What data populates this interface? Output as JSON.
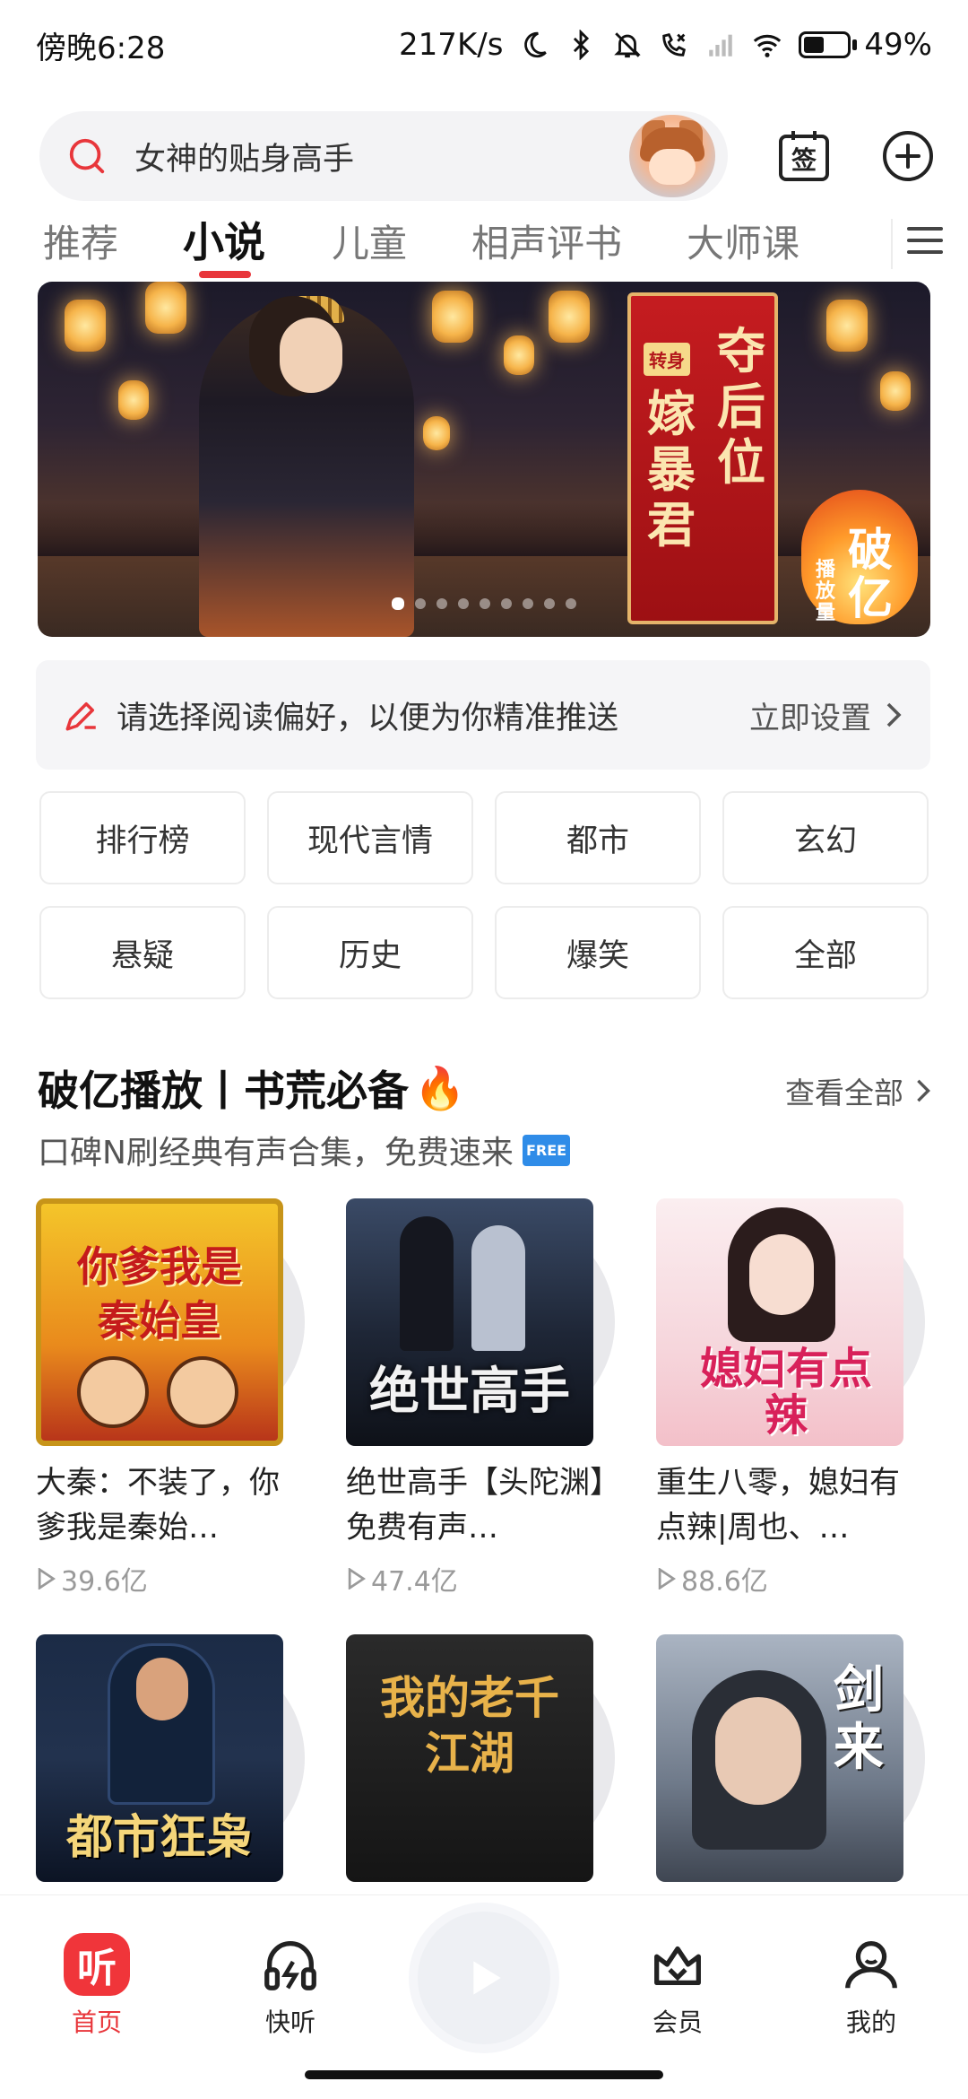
{
  "status_bar": {
    "time": "傍晚6:28",
    "network_speed": "217K/s",
    "battery": "49%",
    "battery_level_percent": 49,
    "icons": [
      "moon-icon",
      "bluetooth-icon",
      "mute-icon",
      "call-forward-icon",
      "signal-icon",
      "wifi-icon",
      "battery-icon"
    ]
  },
  "search": {
    "placeholder": "女神的贴身高手",
    "icons": [
      "search-icon",
      "avatar",
      "sign-in-icon",
      "add-icon"
    ],
    "sign_in_label": "签"
  },
  "tabs": {
    "items": [
      "推荐",
      "小说",
      "儿童",
      "相声评书",
      "大师课"
    ],
    "active": "小说",
    "accent_color": "#e8363b"
  },
  "banner": {
    "book_title_col1": "夺后位",
    "book_title_col2": "嫁暴君",
    "tag": "转身",
    "badge_small": "播放量",
    "badge_big": "破亿",
    "page_count": 9,
    "active_page": 1
  },
  "preference": {
    "text": "请选择阅读偏好，以便为你精准推送",
    "action": "立即设置"
  },
  "categories": [
    "排行榜",
    "现代言情",
    "都市",
    "玄幻",
    "悬疑",
    "历史",
    "爆笑",
    "全部"
  ],
  "section": {
    "title": "破亿播放丨书荒必备",
    "title_emoji": "🔥",
    "subtitle": "口碑N刷经典有声合集，免费速来",
    "free_badge": "FREE",
    "more": "查看全部"
  },
  "books": [
    {
      "title": "大秦：不装了，你爹我是秦始…",
      "plays": "39.6亿",
      "cover_text": "你爹我是秦始皇"
    },
    {
      "title": "绝世高手【头陀渊】免费有声…",
      "plays": "47.4亿",
      "cover_text": "绝世高手"
    },
    {
      "title": "重生八零，媳妇有点辣|周也、…",
      "plays": "88.6亿",
      "cover_text": "媳妇有点辣"
    },
    {
      "title": "",
      "plays": "",
      "cover_text": "都市狂枭"
    },
    {
      "title": "",
      "plays": "",
      "cover_text": "我的老千江湖"
    },
    {
      "title": "",
      "plays": "",
      "cover_text": "剑来"
    }
  ],
  "bottom_nav": {
    "items": [
      {
        "label": "首页",
        "icon": "home-icon",
        "active": true
      },
      {
        "label": "快听",
        "icon": "headphones-icon",
        "active": false
      },
      {
        "label": "",
        "icon": "play-icon",
        "active": false
      },
      {
        "label": "会员",
        "icon": "vip-crown-icon",
        "active": false
      },
      {
        "label": "我的",
        "icon": "profile-icon",
        "active": false
      }
    ],
    "home_badge_text": "听"
  }
}
